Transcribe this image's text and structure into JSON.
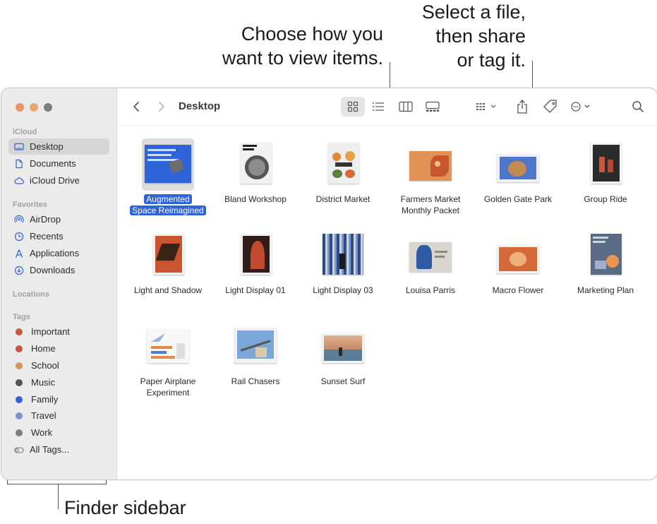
{
  "callouts": {
    "view_line1": "Choose how you",
    "view_line2": "want to view items.",
    "share_line1": "Select a file,",
    "share_line2": "then share",
    "share_line3": "or tag it.",
    "sidebar": "Finder sidebar"
  },
  "window": {
    "title": "Desktop",
    "toolbar": {
      "back_icon": "chevron-left-icon",
      "forward_icon": "chevron-right-icon",
      "view_modes": [
        "icon-view-icon",
        "list-view-icon",
        "column-view-icon",
        "gallery-view-icon"
      ],
      "active_view": "icon-view-icon",
      "group_icon": "group-by-icon",
      "share_icon": "share-icon",
      "tag_icon": "tag-icon",
      "more_icon": "ellipsis-circle-icon",
      "search_icon": "search-icon"
    },
    "traffic_lights": {
      "close": "#e9946b",
      "minimize": "#e3a970",
      "maximize": "#7d7d7d"
    }
  },
  "sidebar": {
    "icloud_label": "iCloud",
    "icloud": [
      {
        "label": "Desktop",
        "icon": "desktop-icon",
        "selected": true
      },
      {
        "label": "Documents",
        "icon": "document-icon"
      },
      {
        "label": "iCloud Drive",
        "icon": "cloud-icon"
      }
    ],
    "favorites_label": "Favorites",
    "favorites": [
      {
        "label": "AirDrop",
        "icon": "airdrop-icon"
      },
      {
        "label": "Recents",
        "icon": "clock-icon"
      },
      {
        "label": "Applications",
        "icon": "applications-icon"
      },
      {
        "label": "Downloads",
        "icon": "download-icon"
      }
    ],
    "locations_label": "Locations",
    "tags_label": "Tags",
    "tags": [
      {
        "label": "Important",
        "color": "#c8553d"
      },
      {
        "label": "Home",
        "color": "#c8553d"
      },
      {
        "label": "School",
        "color": "#d9925b"
      },
      {
        "label": "Music",
        "color": "#555555"
      },
      {
        "label": "Family",
        "color": "#2f63d8"
      },
      {
        "label": "Travel",
        "color": "#7b93d3"
      },
      {
        "label": "Work",
        "color": "#7d7d7d"
      }
    ],
    "all_tags": "All Tags..."
  },
  "files": [
    {
      "line1": "Augmented",
      "line2": "Space Reimagined",
      "selected": true
    },
    {
      "line1": "Bland Workshop",
      "line2": ""
    },
    {
      "line1": "District Market",
      "line2": ""
    },
    {
      "line1": "Farmers Market",
      "line2": "Monthly Packet"
    },
    {
      "line1": "Golden Gate Park",
      "line2": ""
    },
    {
      "line1": "Group Ride",
      "line2": ""
    },
    {
      "line1": "Light and Shadow",
      "line2": ""
    },
    {
      "line1": "Light Display 01",
      "line2": ""
    },
    {
      "line1": "Light Display 03",
      "line2": ""
    },
    {
      "line1": "Louisa Parris",
      "line2": ""
    },
    {
      "line1": "Macro Flower",
      "line2": ""
    },
    {
      "line1": "Marketing Plan",
      "line2": ""
    },
    {
      "line1": "Paper Airplane",
      "line2": "Experiment"
    },
    {
      "line1": "Rail Chasers",
      "line2": ""
    },
    {
      "line1": "Sunset Surf",
      "line2": ""
    }
  ]
}
